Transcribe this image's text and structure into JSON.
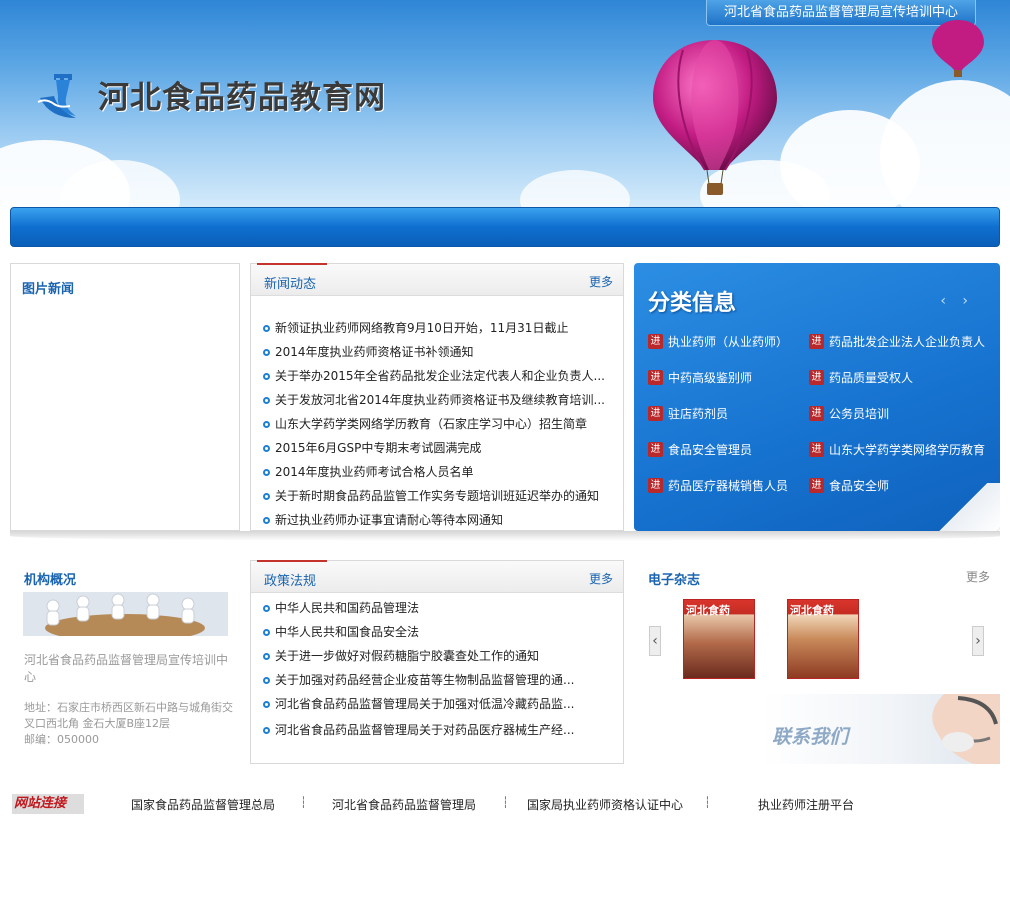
{
  "header": {
    "badge": "河北省食品药品监督管理局宣传培训中心",
    "site_title": "河北食品药品教育网"
  },
  "pic_news": {
    "title": "图片新闻"
  },
  "news": {
    "title": "新闻动态",
    "more": "更多",
    "items": [
      "新领证执业药师网络教育9月10日开始，11月31日截止",
      "2014年度执业药师资格证书补领通知",
      "关于举办2015年全省药品批发企业法定代表人和企业负责人...",
      "关于发放河北省2014年度执业药师资格证书及继续教育培训...",
      "山东大学药学类网络学历教育（石家庄学习中心）招生简章",
      "2015年6月GSP中专期末考试圆满完成",
      "2014年度执业药师考试合格人员名单",
      "关于新时期食品药品监管工作实务专题培训班延迟举办的通知",
      "新过执业药师办证事宜请耐心等待本网通知"
    ]
  },
  "categories": {
    "title": "分类信息",
    "arrows": "‹ ›",
    "badge": "进",
    "left": [
      "执业药师（从业药师）",
      "中药高级鉴别师",
      "驻店药剂员",
      "食品安全管理员",
      "药品医疗器械销售人员"
    ],
    "right": [
      "药品批发企业法人企业负责人",
      "药品质量受权人",
      "公务员培训",
      "山东大学药学类网络学历教育",
      "食品安全师"
    ]
  },
  "org": {
    "title": "机构概况",
    "name": "河北省食品药品监督管理局宣传培训中心",
    "address": "地址：石家庄市桥西区新石中路与城角街交叉口西北角 金石大厦B座12层",
    "postcode": "邮编：050000"
  },
  "policy": {
    "title": "政策法规",
    "more": "更多",
    "items": [
      "中华人民共和国药品管理法",
      "中华人民共和国食品安全法",
      "关于进一步做好对假药糖脂宁胶囊查处工作的通知",
      "关于加强对药品经营企业疫苗等生物制品监督管理的通...",
      "河北省食品药品监督管理局关于加强对低温冷藏药品监...",
      "河北省食品药品监督管理局关于对药品医疗器械生产经..."
    ]
  },
  "ezine": {
    "title": "电子杂志",
    "more": "更多",
    "mag_titles": [
      "河北食药",
      "河北食药"
    ],
    "prev": "‹",
    "next": "›"
  },
  "contact": {
    "text": "联系我们"
  },
  "links": {
    "label": "网站连接",
    "items": [
      "国家食品药品监督管理总局",
      "河北省食品药品监督管理局",
      "国家局执业药师资格认证中心",
      "执业药师注册平台"
    ],
    "separator": "┆"
  },
  "colors": {
    "brand_blue": "#1a64b0",
    "nav_blue": "#0f6fd0",
    "accent_red": "#c4332c"
  }
}
